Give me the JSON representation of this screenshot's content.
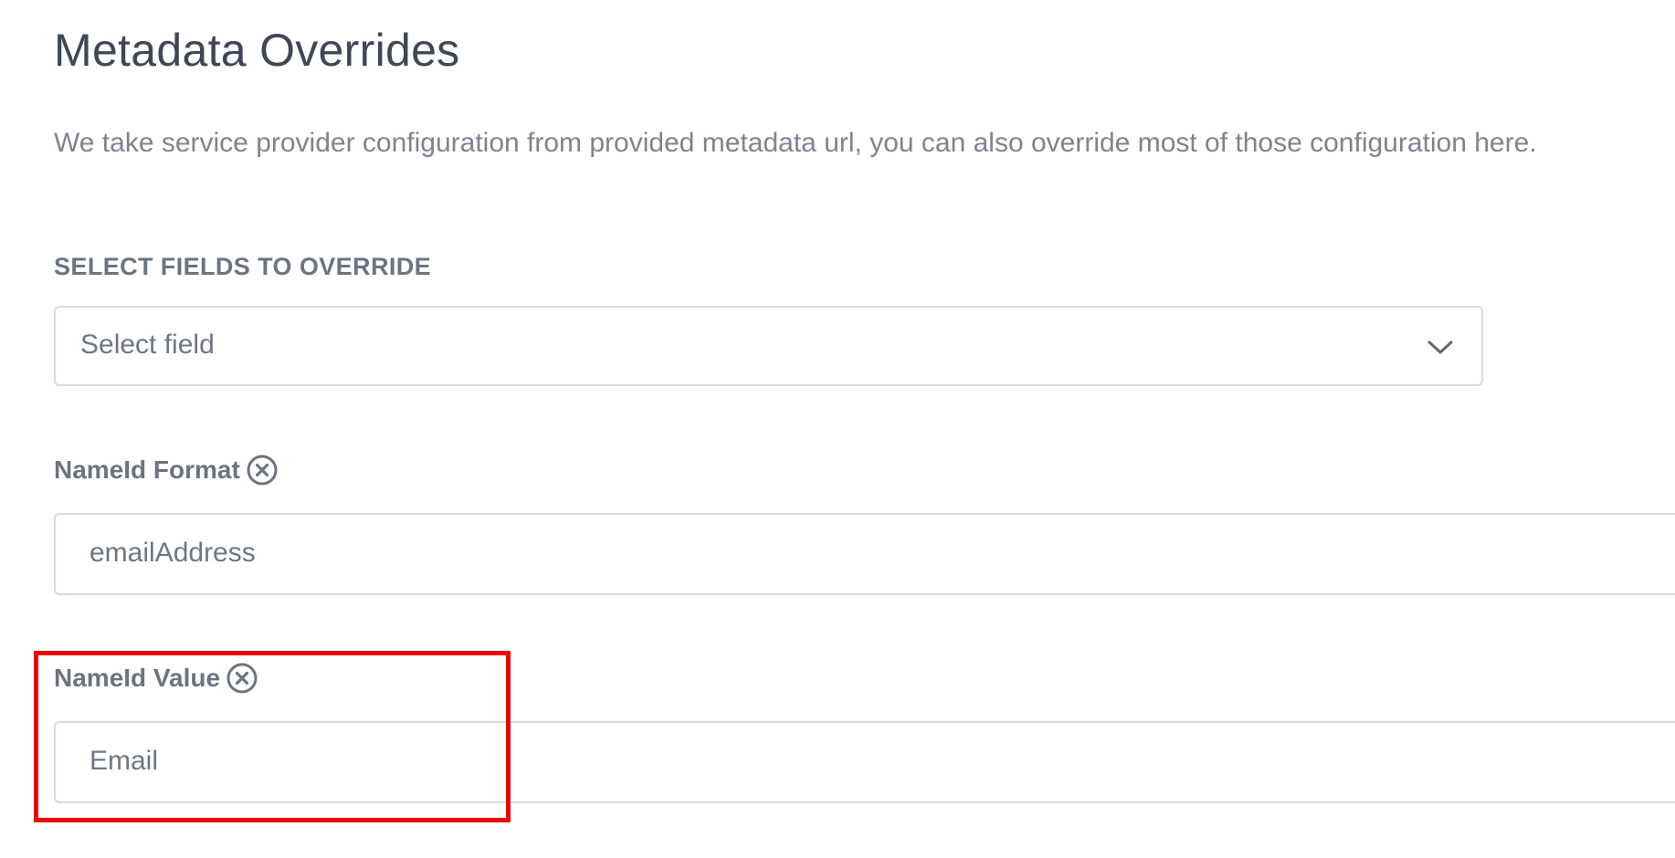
{
  "page": {
    "title": "Metadata Overrides",
    "description": "We take service provider configuration from provided metadata url, you can also override most of those configuration here."
  },
  "override_select": {
    "section_label": "SELECT FIELDS TO OVERRIDE",
    "value": "Select field",
    "icon": "chevron-down-icon"
  },
  "fields": [
    {
      "label": "NameId Format",
      "clear_icon": "close-circle-icon",
      "value": "emailAddress"
    },
    {
      "label": "NameId Value",
      "clear_icon": "close-circle-icon",
      "value": "Email"
    }
  ],
  "colors": {
    "highlight": "#f00000",
    "border": "#d7dbe0",
    "title": "#3f4756",
    "muted_text": "#7b8591"
  }
}
